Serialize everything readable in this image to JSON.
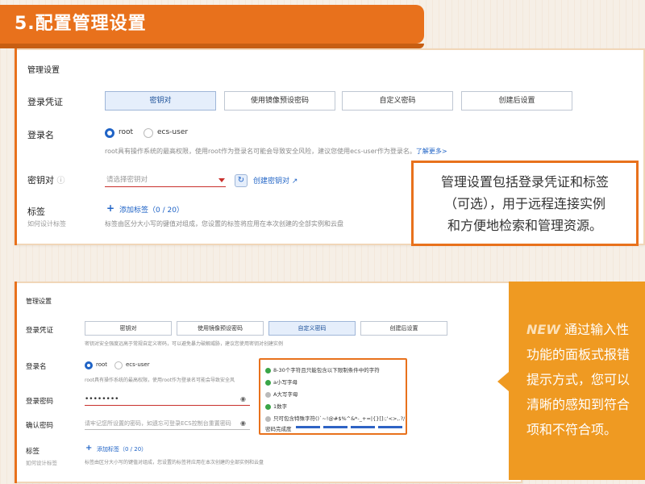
{
  "header": {
    "title": "5.配置管理设置"
  },
  "panel1": {
    "title": "管理设置",
    "credential_label": "登录凭证",
    "tabs": [
      "密钥对",
      "使用镜像预设密码",
      "自定义密码",
      "创建后设置"
    ],
    "login_name_label": "登录名",
    "login_options": [
      "root",
      "ecs-user"
    ],
    "root_hint": "root具有操作系统的最高权限，使用root作为登录名可能会导致安全风险，建议您使用ecs-user作为登录名。",
    "learn_more": "了解更多>",
    "keypair_label": "密钥对",
    "keypair_placeholder": "请选择密钥对",
    "create_keypair": "创建密钥对",
    "tag_label": "标签",
    "tag_sub": "如何设计标签",
    "add_tag": "添加标签（0 / 20）",
    "tag_hint": "标签由区分大小写的键值对组成，您设置的标签将应用在本次创建的全部实例和云盘"
  },
  "callout1": {
    "lines": [
      "管理设置包括登录凭证和标签",
      "（可选），用于远程连接实例",
      "和方便地检索和管理资源。"
    ]
  },
  "panel2": {
    "title": "管理设置",
    "credential_label": "登录凭证",
    "tabs": [
      "密钥对",
      "使用镜像预设密码",
      "自定义密码",
      "创建后设置"
    ],
    "credential_hint": "密钥对安全强度远高于常规自定义密码，可以避免暴力破解威胁，建议您使用密钥对创建实例",
    "login_name_label": "登录名",
    "login_options": [
      "root",
      "ecs-user"
    ],
    "root_hint": "root具有操作系统的最高权限，使用root作为登录名可能会导致安全风",
    "password_label": "登录密码",
    "password_value": "••••••••",
    "confirm_label": "确认密码",
    "confirm_placeholder": "请牢记您所设置的密码，如遗忘可登录ECS控制台重置密码",
    "tag_label": "标签",
    "tag_sub": "如何设计标签",
    "add_tag": "添加标签（0 / 20）",
    "tag_hint": "标签由区分大小写的键值对组成，您设置的标签将应用在本次创建的全部实例和云盘"
  },
  "password_popup": {
    "rules": [
      {
        "text": "8-30个字符且只能包含以下限制条件中的字符",
        "ok": true
      },
      {
        "text": "a小写字母",
        "ok": true
      },
      {
        "text": "A大写字母",
        "ok": false
      },
      {
        "text": "1数字",
        "ok": true
      },
      {
        "text": "只可包含特殊字符()`~!@#$%^&*-_+=|{}[]:;'<>,.?/",
        "ok": false
      }
    ],
    "strength_label": "密码完成度"
  },
  "callout2": {
    "new_word": "NEW",
    "lines": [
      "通过输入性",
      "功能的面板式报错",
      "提示方式，您可以",
      "清晰的感知到符合",
      "项和不符合项。"
    ]
  },
  "colors": {
    "accent": "#e8711c",
    "link": "#1f63c6",
    "error": "#c9302c"
  }
}
